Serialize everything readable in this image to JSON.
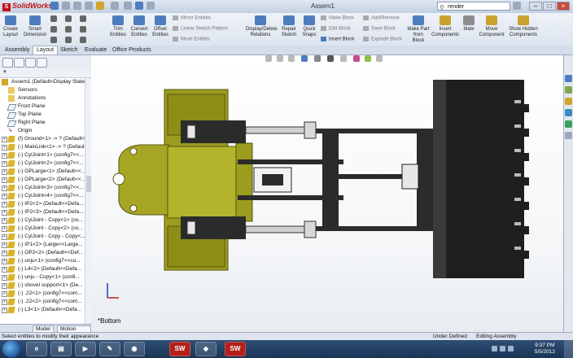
{
  "app": {
    "name": "SolidWorks",
    "document_title": "Assem1"
  },
  "search": {
    "placeholder": "render"
  },
  "window_buttons": [
    "–",
    "□",
    "×"
  ],
  "ribbon": {
    "buttons": [
      {
        "label": "Create Layout"
      },
      {
        "label": "Smart Dimension"
      },
      {
        "label": "Trim Entities"
      },
      {
        "label": "Convert Entities"
      },
      {
        "label": "Offset Entities"
      },
      {
        "label": "Display/Delete Relations"
      },
      {
        "label": "Repair Sketch"
      },
      {
        "label": "Quick Snaps"
      },
      {
        "label": "Make Part from Block"
      },
      {
        "label": "Insert Components"
      },
      {
        "label": "Mate"
      },
      {
        "label": "Move Component"
      },
      {
        "label": "Show Hidden Components"
      }
    ],
    "small_buttons": [
      {
        "label": "Mirror Entities"
      },
      {
        "label": "Linear Sketch Pattern"
      },
      {
        "label": "Move Entities"
      },
      {
        "label": "Make Block"
      },
      {
        "label": "Edit Block"
      },
      {
        "label": "Insert Block"
      },
      {
        "label": "Add/Remove"
      },
      {
        "label": "Save Block"
      },
      {
        "label": "Explode Block"
      }
    ]
  },
  "command_tabs": [
    "Assembly",
    "Layout",
    "Sketch",
    "Evaluate",
    "Office Products"
  ],
  "active_tab": "Layout",
  "tree": [
    "Assem1  (Default<Display State-1>)",
    "Sensors",
    "Annotations",
    "Front Plane",
    "Top Plane",
    "Right Plane",
    "Origin",
    "(f) Ground<1> -> ? (Default<<...",
    "(-) MainLink<1> -> ? (Default<...",
    "(-) CylJoint<1> (config7<<...",
    "(-) CylJoint<2> (config7<<...",
    "(-) OPLarge<1> (Default<<...",
    "(-) OPLarge<2> (Default<<...",
    "(-) CylJoint<3> (config7<<...",
    "(-) CylJoint<4> (config7<<...",
    "(-) IP2<2> (Default<<Defa...",
    "(-) IP2<3> (Default<<Defa...",
    "(-) CylJoint - Copy<1> (co...",
    "(-) CylJoint - Copy<2> (co...",
    "(-) CylJoint - Copy - Copy<...",
    "(-) IP1<2> (Large<<Large...",
    "(-) OP2<2> (Default<<Def...",
    "(-) unju<1> (config7<<co...",
    "(-) L4<2> (Default<<Defa...",
    "(-) unju - Copy<1> (confi...",
    "(-) shovel support<1> (De...",
    "(-) .22<1> (config7<<com...",
    "(-) .22<2> (config7<<com...",
    "(-) L3<1> (Default<<Defa..."
  ],
  "bottom_tabs": [
    "Model",
    "Motion Study 1"
  ],
  "viewport": {
    "view_label": "*Bottom"
  },
  "status": {
    "message": "Select entities to modify their appearance",
    "state": "Under Defined",
    "mode": "Editing Assembly"
  },
  "clock": {
    "time": "9:37 PM",
    "date": "5/5/2012"
  },
  "colors": {
    "part_fill": "#9c9c1e",
    "part_dark": "#555410",
    "metal": "#2b2b2b",
    "accent": "#c0141a"
  }
}
